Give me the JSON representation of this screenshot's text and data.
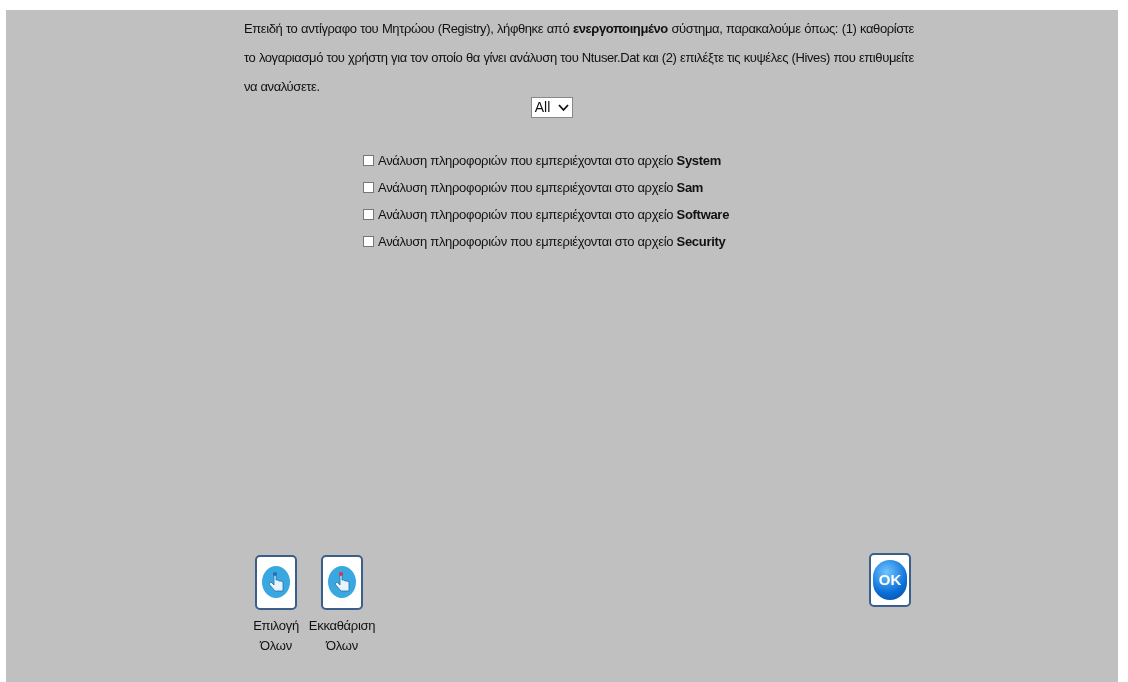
{
  "intro": "Επειδή το αντίγραφο του Μητρώου (Registry), λήφθηκε από **ενεργοποιημένο** σύστημα, παρακαλούμε όπως: (1) καθορίστε το λογαριασμό του χρήστη για τον οποίο θα γίνει ανάλυση του Ntuser.Dat και (2) επιλέξτε τις κυψέλες (Hives) που επιθυμείτε να αναλύσετε.",
  "user_select": {
    "value": "All"
  },
  "hives": [
    {
      "label": "Ανάλυση πληροφοριών που εμπεριέχονται στο αρχείο **System**",
      "checked": false
    },
    {
      "label": "Ανάλυση πληροφοριών που εμπεριέχονται στο αρχείο **Sam**",
      "checked": false
    },
    {
      "label": "Ανάλυση πληροφοριών που εμπεριέχονται στο αρχείο **Software**",
      "checked": false
    },
    {
      "label": "Ανάλυση πληροφοριών που εμπεριέχονται στο αρχείο **Security**",
      "checked": false
    }
  ],
  "actions": [
    {
      "kind": "select",
      "label": "Επιλογή Όλων"
    },
    {
      "kind": "clear",
      "label": "Εκκαθάριση Όλων"
    }
  ],
  "ok_button": {
    "label": "OK"
  }
}
